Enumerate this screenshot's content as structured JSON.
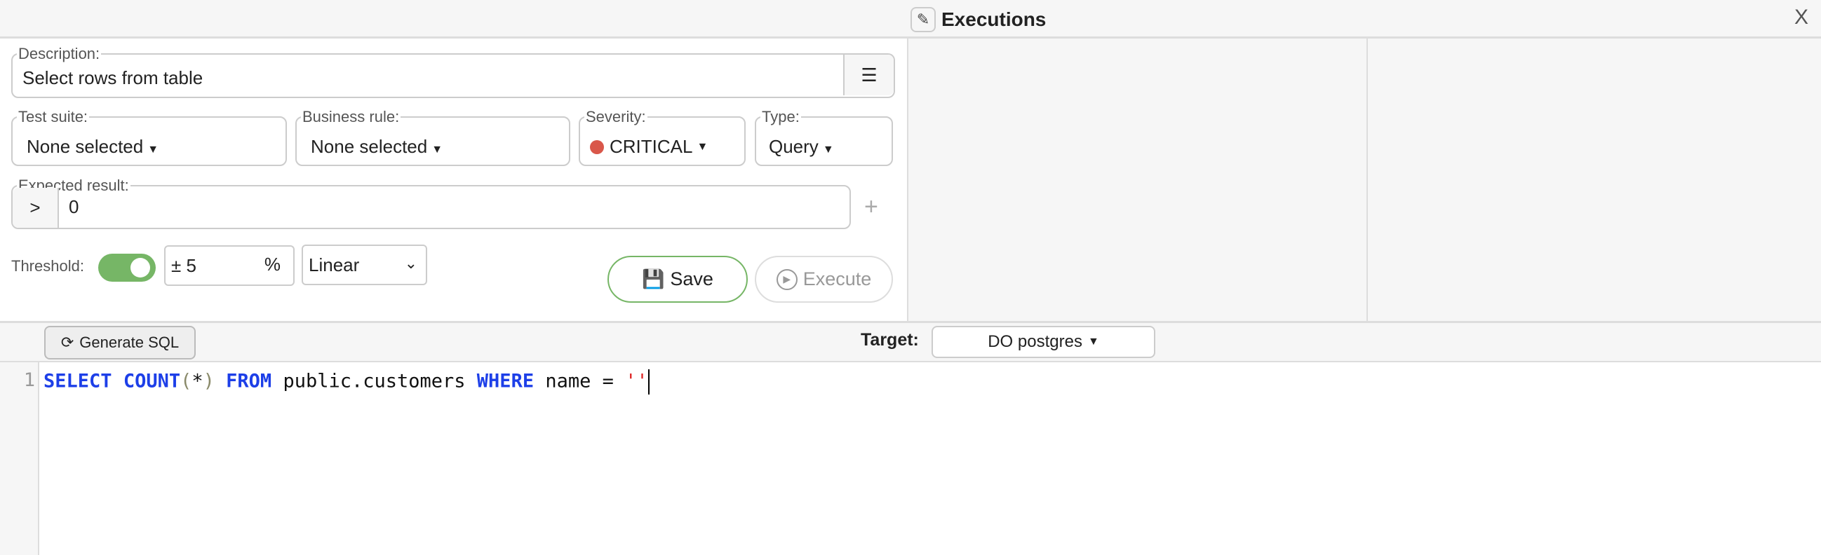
{
  "header": {
    "title": "Executions",
    "edit_icon": "edit-icon",
    "close_icon": "close-icon",
    "close_label": "X"
  },
  "form": {
    "description": {
      "label": "Description:",
      "value": "Select rows from table",
      "icon": "list-icon"
    },
    "test_suite": {
      "label": "Test suite:",
      "value": "None selected"
    },
    "business_rule": {
      "label": "Business rule:",
      "value": "None selected"
    },
    "severity": {
      "label": "Severity:",
      "value": "CRITICAL",
      "color": "#d9574a"
    },
    "type": {
      "label": "Type:",
      "value": "Query"
    },
    "expected_result": {
      "label": "Expected result:",
      "operator": ">",
      "value": "0",
      "add_label": "+"
    },
    "threshold": {
      "label": "Threshold:",
      "enabled": true,
      "prefix": "±",
      "value": "5",
      "unit": "%",
      "mode": "Linear",
      "toggle_color": "#76b666"
    },
    "save_label": "Save",
    "execute_label": "Execute"
  },
  "toolbar": {
    "generate_sql_label": "Generate SQL",
    "target_label": "Target:",
    "target_value": "DO postgres"
  },
  "editor": {
    "line_number": "1",
    "tokens": [
      {
        "t": "SELECT",
        "c": "kw"
      },
      {
        "t": " ",
        "c": ""
      },
      {
        "t": "COUNT",
        "c": "kw"
      },
      {
        "t": "(",
        "c": "pn"
      },
      {
        "t": "*",
        "c": ""
      },
      {
        "t": ")",
        "c": "pn"
      },
      {
        "t": " ",
        "c": ""
      },
      {
        "t": "FROM",
        "c": "kw"
      },
      {
        "t": " public.customers ",
        "c": ""
      },
      {
        "t": "WHERE",
        "c": "kw"
      },
      {
        "t": " name = ",
        "c": ""
      },
      {
        "t": "''",
        "c": "st"
      }
    ]
  }
}
